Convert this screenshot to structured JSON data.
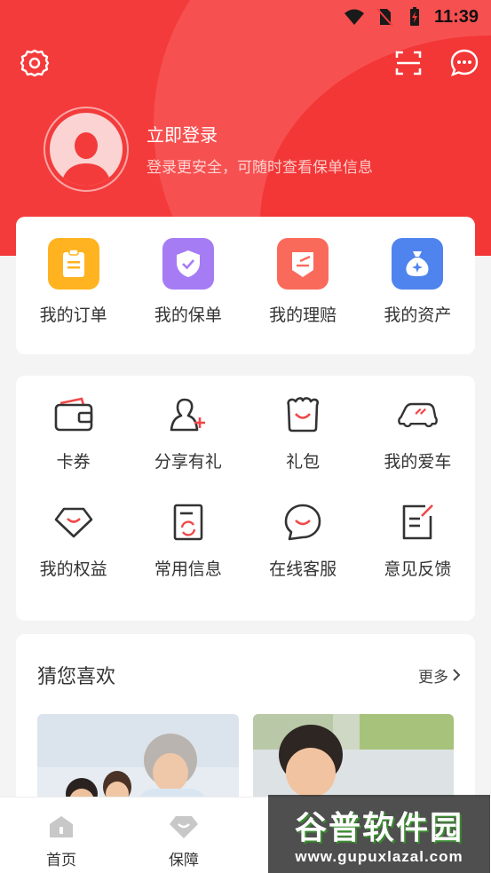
{
  "status_bar": {
    "time": "11:39",
    "icons": [
      "wifi-icon",
      "no-sim-icon",
      "battery-charging-icon"
    ]
  },
  "header": {
    "icons": [
      "settings-icon",
      "scan-icon",
      "message-icon"
    ],
    "login_title": "立即登录",
    "login_subtitle": "登录更安全，可随时查看保单信息"
  },
  "orders": [
    {
      "label": "我的订单",
      "icon": "clipboard-icon",
      "color": "#ffb320"
    },
    {
      "label": "我的保单",
      "icon": "shield-check-icon",
      "color": "#a67cf4"
    },
    {
      "label": "我的理赔",
      "icon": "claim-edit-icon",
      "color": "#fa6a5a"
    },
    {
      "label": "我的资产",
      "icon": "money-bag-icon",
      "color": "#4f83ee"
    }
  ],
  "services": [
    {
      "label": "卡券",
      "icon": "wallet-icon"
    },
    {
      "label": "分享有礼",
      "icon": "add-person-icon"
    },
    {
      "label": "礼包",
      "icon": "gift-bag-icon"
    },
    {
      "label": "我的爱车",
      "icon": "car-icon"
    },
    {
      "label": "我的权益",
      "icon": "diamond-icon"
    },
    {
      "label": "常用信息",
      "icon": "document-refresh-icon"
    },
    {
      "label": "在线客服",
      "icon": "chat-smile-icon"
    },
    {
      "label": "意见反馈",
      "icon": "feedback-edit-icon"
    }
  ],
  "guess": {
    "title": "猜您喜欢",
    "more": "更多"
  },
  "bottom_nav": [
    {
      "label": "首页",
      "icon": "home-icon"
    },
    {
      "label": "保障",
      "icon": "diamond-icon"
    },
    {
      "label": "",
      "icon": "hidden-item"
    },
    {
      "label": "",
      "icon": "hidden-item"
    }
  ],
  "watermark": {
    "main": "谷普软件园",
    "url": "www.gupuxlazal.com"
  },
  "colors": {
    "accent": "#f43b3b",
    "icon_red": "#f04848",
    "icon_dark": "#333333"
  }
}
